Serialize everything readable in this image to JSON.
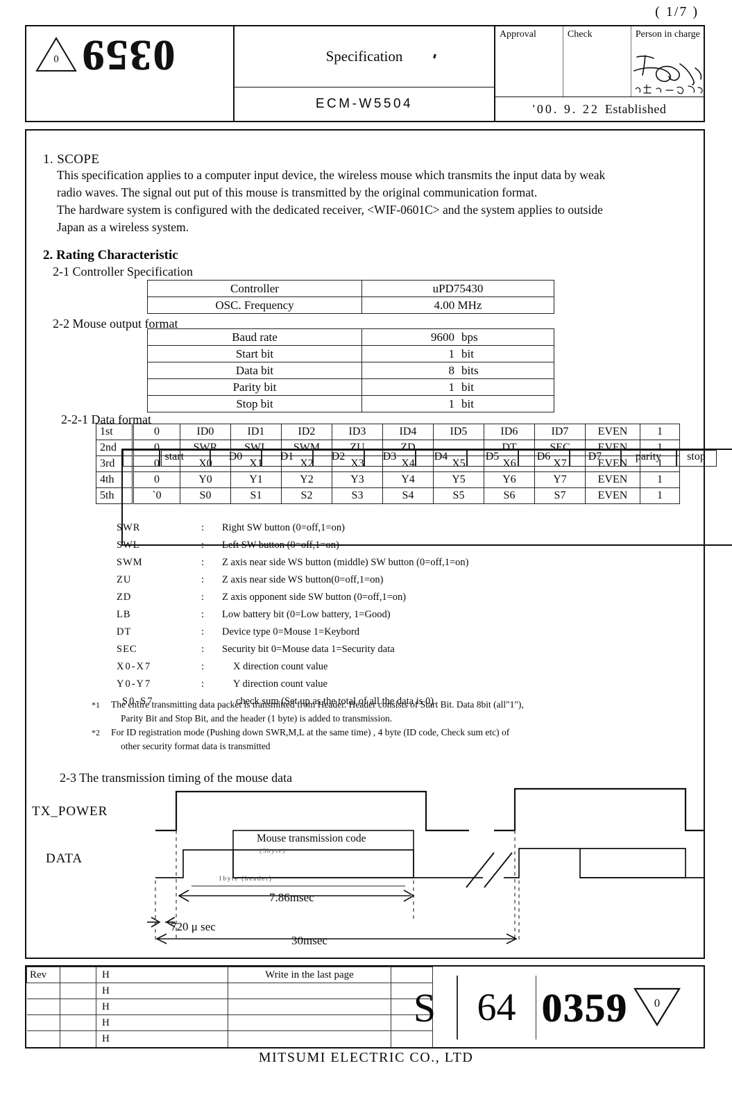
{
  "page": {
    "page_indicator": "( 1/7 )"
  },
  "header": {
    "stamp_number": "0359",
    "stamp_triangle_mark": "0",
    "title": "Specification",
    "part_number": "ECM-W5504",
    "approval_label": "Approval",
    "check_label": "Check",
    "person_in_charge_label": "Person in charge",
    "established_date": "'00. 9. 22",
    "established_label": "Established"
  },
  "scope": {
    "heading": "1. SCOPE",
    "lines": [
      "This specification applies to a computer input device, the wireless mouse which transmits the input data by weak",
      "radio waves. The signal out put of this mouse is transmitted by the original communication format.",
      "The hardware system is configured with the dedicated receiver, <WIF-0601C> and the system applies to outside",
      "Japan as a wireless system."
    ]
  },
  "rating": {
    "heading": "2. Rating Characteristic",
    "sub_2_1": "2-1 Controller Specification",
    "sub_2_2": "2-2 Mouse output format",
    "sub_2_2_1": "2-2-1 Data format",
    "sub_2_3": "2-3 The transmission timing of the mouse data",
    "controller_table": [
      {
        "label": "Controller",
        "value": "uPD75430",
        "num": "",
        "unit": ""
      },
      {
        "label": "OSC. Frequency",
        "value": "4.00 MHz",
        "num": "",
        "unit": ""
      }
    ],
    "output_table": [
      {
        "label": "Baud rate",
        "num": "9600",
        "unit": "bps"
      },
      {
        "label": "Start bit",
        "num": "1",
        "unit": "bit"
      },
      {
        "label": "Data bit",
        "num": "8",
        "unit": "bits"
      },
      {
        "label": "Parity bit",
        "num": "1",
        "unit": "bit"
      },
      {
        "label": "Stop bit",
        "num": "1",
        "unit": "bit"
      }
    ]
  },
  "data_format": {
    "columns": [
      "",
      "start",
      "D0",
      "D1",
      "D2",
      "D3",
      "D4",
      "D5",
      "D6",
      "D7",
      "parity",
      "stop"
    ],
    "rows": [
      {
        "name": "1st",
        "start": "0",
        "d": [
          "ID0",
          "ID1",
          "ID2",
          "ID3",
          "ID4",
          "ID5",
          "ID6",
          "ID7"
        ],
        "parity": "EVEN",
        "stop": "1"
      },
      {
        "name": "2nd",
        "start": "0",
        "d": [
          "SWR",
          "SWL",
          "SWM",
          "ZU",
          "ZD",
          "",
          "DT",
          "SEC"
        ],
        "parity": "EVEN",
        "stop": "1"
      },
      {
        "name": "3rd",
        "start": "0",
        "d": [
          "X0",
          "X1",
          "X2",
          "X3",
          "X4",
          "X5",
          "X6",
          "X7"
        ],
        "parity": "EVEN",
        "stop": "1"
      },
      {
        "name": "4th",
        "start": "0",
        "d": [
          "Y0",
          "Y1",
          "Y2",
          "Y3",
          "Y4",
          "Y5",
          "Y6",
          "Y7"
        ],
        "parity": "EVEN",
        "stop": "1"
      },
      {
        "name": "5th",
        "start": "`0",
        "d": [
          "S0",
          "S1",
          "S2",
          "S3",
          "S4",
          "S5",
          "S6",
          "S7"
        ],
        "parity": "EVEN",
        "stop": "1"
      }
    ]
  },
  "legend": [
    {
      "key": "SWR",
      "colon": ":",
      "value": "Right SW button  (0=off,1=on)"
    },
    {
      "key": "SWL",
      "colon": ":",
      "value": "Left SW button  (0=off,1=on)"
    },
    {
      "key": "SWM",
      "colon": ":",
      "value": "Z axis near side WS button (middle) SW button  (0=off,1=on)"
    },
    {
      "key": "ZU",
      "colon": ":",
      "value": "Z axis near side WS button(0=off,1=on)"
    },
    {
      "key": "ZD",
      "colon": ":",
      "value": "Z axis opponent side SW button  (0=off,1=on)"
    },
    {
      "key": "LB",
      "colon": ":",
      "value": "Low battery bit    (0=Low battery, 1=Good)"
    },
    {
      "key": "DT",
      "colon": ":",
      "value": "Device type   0=Mouse    1=Keybord"
    },
    {
      "key": "SEC",
      "colon": ":",
      "value": "Security bit   0=Mouse data    1=Security data"
    },
    {
      "key": "X0-X7",
      "colon": ":",
      "value": "X  direction count value"
    },
    {
      "key": "Y0-Y7",
      "colon": ":",
      "value": "Y  direction count value"
    },
    {
      "key": "S0-S7",
      "colon": ":",
      "value": "check sum   (Set up as the total of all the data is 0)"
    }
  ],
  "notes": [
    {
      "marker": "*1",
      "line1": "The entire transmitting data packet is transmitted from Header. Header consists of Start Bit. Data 8bit (all\"1\"),",
      "line2": "Parity Bit and Stop Bit, and the header (1 byte) is added to transmission."
    },
    {
      "marker": "*2",
      "line1": "For ID registration mode  (Pushing down SWR,M,L at the same time)  , 4 byte  (ID code, Check sum etc) of",
      "line2": "other security format data is transmitted"
    }
  ],
  "timing": {
    "tx_power_label": "TX_POWER",
    "data_label": "DATA",
    "mouse_code_label": "Mouse transmission code",
    "mouse_code_sublabel": "(5byte)",
    "header_byte_label": "1byte (header)",
    "duration_packet": "7.86msec",
    "duration_leadin": "720 μ sec",
    "duration_period": "30msec"
  },
  "revision": {
    "rev_label": "Rev",
    "h_label": "H",
    "h_dots": ".   .   .",
    "note": "Write in the last page",
    "row_count": 5
  },
  "footer": {
    "stamp_prefix": "S",
    "stamp_group": "64",
    "stamp_serial": "0359",
    "stamp_triangle_mark": "0",
    "company": "MITSUMI ELECTRIC CO., LTD"
  }
}
